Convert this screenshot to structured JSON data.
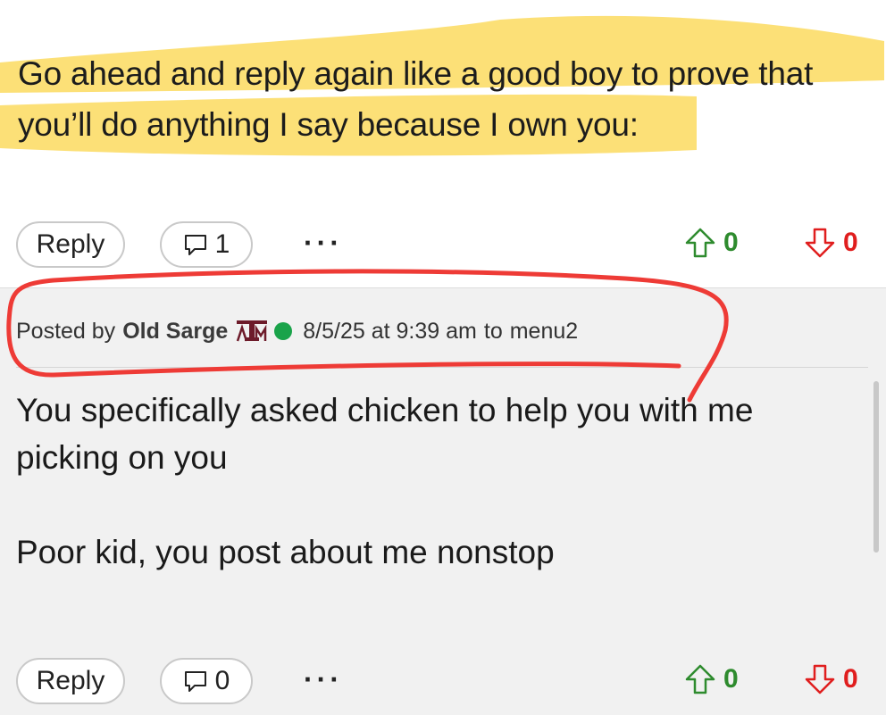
{
  "top_post": {
    "body_lines": [
      "Go ahead and reply again like a good boy to prove that",
      "you’ll do anything I say because I own you:"
    ],
    "actions": {
      "reply_label": "Reply",
      "reply_count": "1",
      "more_label": "···",
      "upvotes": "0",
      "downvotes": "0"
    }
  },
  "reply_post": {
    "posted_by_label": "Posted by",
    "author": "Old Sarge",
    "date": "8/5/25 at 9:39 am",
    "to_label": "to",
    "target_user": "menu2",
    "body_paragraphs": [
      "You specifically asked chicken to help you with me picking on you",
      "Poor kid, you post about me nonstop"
    ],
    "actions": {
      "reply_label": "Reply",
      "reply_count": "0",
      "more_label": "···",
      "upvotes": "0",
      "downvotes": "0"
    }
  },
  "colors": {
    "highlight": "#fbd54a",
    "annotation": "#ee3b36",
    "upvote": "#2e8b2e",
    "downvote": "#e01e1e",
    "online": "#1aa34a",
    "reply_background": "#f1f1f1",
    "team_logo": "#6d1b2a"
  },
  "icons": {
    "comment": "speech-bubble-icon",
    "upvote": "arrow-up-icon",
    "downvote": "arrow-down-icon",
    "team": "texas-am-logo-icon",
    "status": "online-dot-icon"
  }
}
